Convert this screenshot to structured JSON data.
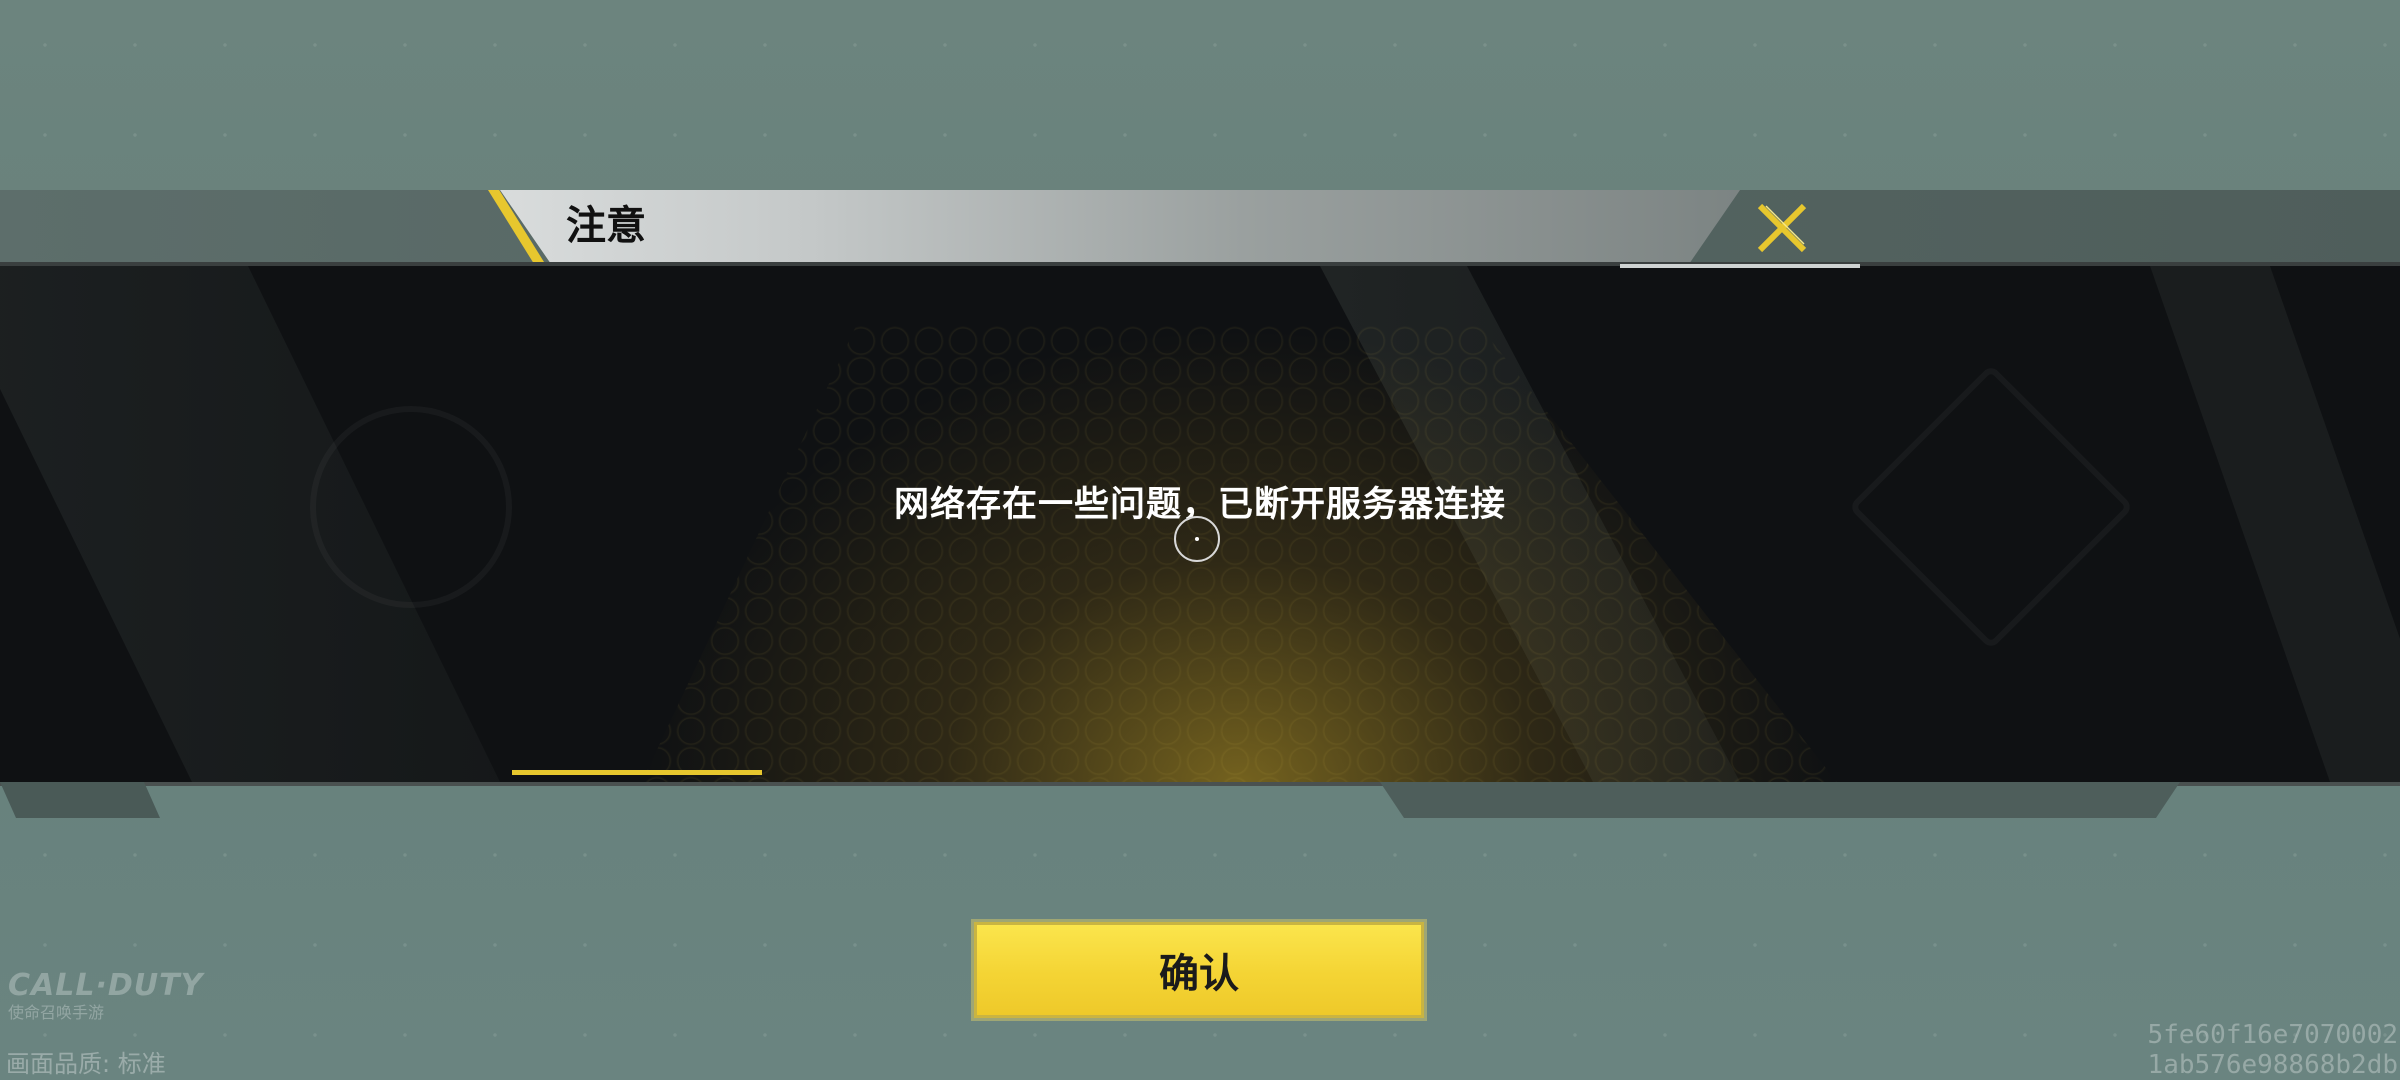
{
  "dialog": {
    "title": "注意",
    "message": "网络存在一些问题，已断开服务器连接",
    "confirm_label": "确认",
    "close_icon": "close-x-icon",
    "accent_color": "#e7c72e"
  },
  "footer": {
    "logo_line1": "CALL·DUTY",
    "logo_line2": "使命召唤手游",
    "quality_text": "画面品质: 标准",
    "hash_line1": "5fe60f16e7070002",
    "hash_line2": "1ab576e98868b2db"
  }
}
